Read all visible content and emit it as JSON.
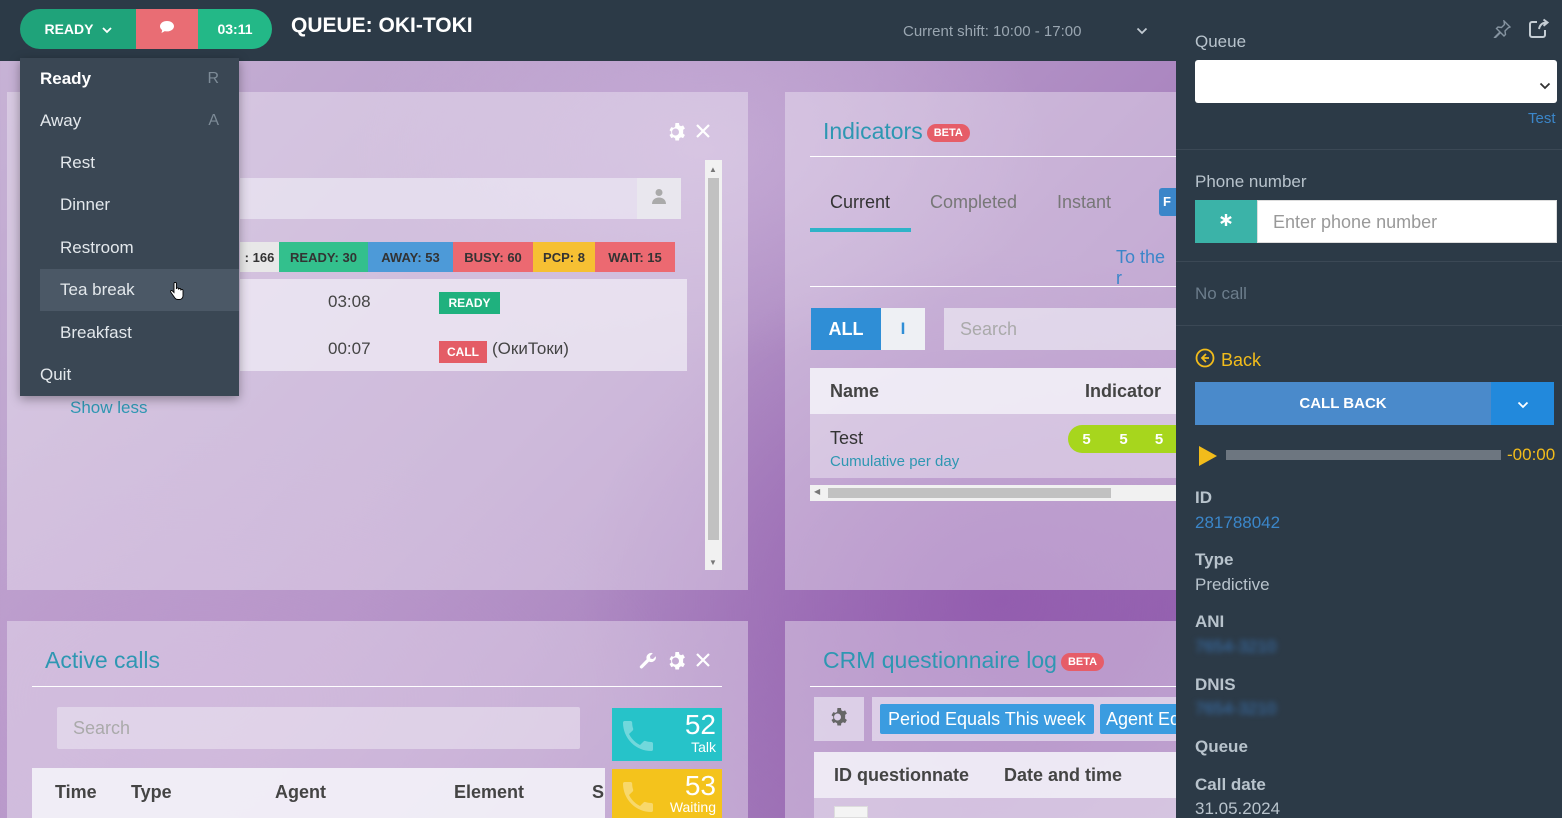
{
  "topbar": {
    "status_label": "READY",
    "timer": "03:11",
    "queue_title": "QUEUE: OKI-TOKI",
    "shift_text": "Current shift: 10:00 - 17:00"
  },
  "status_menu": {
    "items": [
      {
        "label": "Ready",
        "key": "R"
      },
      {
        "label": "Away",
        "key": "A"
      },
      {
        "label": "Rest"
      },
      {
        "label": "Dinner"
      },
      {
        "label": "Restroom"
      },
      {
        "label": "Tea break"
      },
      {
        "label": "Breakfast"
      },
      {
        "label": "Quit"
      }
    ]
  },
  "agents_panel": {
    "chips": [
      {
        "label": ": 166",
        "color": "#e8e8e8"
      },
      {
        "label": "READY: 30",
        "color": "#33c08d"
      },
      {
        "label": "AWAY: 53",
        "color": "#4d9ad8"
      },
      {
        "label": "BUSY: 60",
        "color": "#ec6971"
      },
      {
        "label": "PCP: 8",
        "color": "#f6c033"
      },
      {
        "label": "WAIT: 15",
        "color": "#ec6971"
      }
    ],
    "rows": [
      {
        "time": "03:08",
        "badge": "READY",
        "extra": ""
      },
      {
        "time": "00:07",
        "badge": "CALL",
        "extra": "(ОкиТоки)"
      }
    ],
    "show_less": "Show less"
  },
  "indicators_panel": {
    "title": "Indicators",
    "beta": "BETA",
    "tabs": [
      "Current",
      "Completed",
      "Instant"
    ],
    "link": "To the r",
    "filter_all": "ALL",
    "filter_i": "I",
    "search_placeholder": "Search",
    "col_name": "Name",
    "col_indicator": "Indicator",
    "row_name": "Test",
    "row_sub": "Cumulative per day",
    "row_values": [
      "5",
      "5",
      "5"
    ]
  },
  "active_calls_panel": {
    "title": "Active calls",
    "search_placeholder": "Search",
    "talk_count": "52",
    "talk_label": "Talk",
    "waiting_count": "53",
    "waiting_label": "Waiting",
    "columns": [
      "Time",
      "Type",
      "Agent",
      "Element",
      "S"
    ]
  },
  "crm_panel": {
    "title": "CRM questionnaire log",
    "beta": "BETA",
    "filter1": "Period Equals This week",
    "filter2": "Agent Eq",
    "col_id": "ID questionnate",
    "col_date": "Date and time"
  },
  "sidebar": {
    "queue_label": "Queue",
    "queue_link": "Test",
    "phone_label": "Phone number",
    "phone_placeholder": "Enter phone number",
    "no_call": "No call",
    "back": "Back",
    "call_back": "CALL BACK",
    "audio_time": "-00:00",
    "id_label": "ID",
    "id_value": "281788042",
    "type_label": "Type",
    "type_value": "Predictive",
    "ani_label": "ANI",
    "ani_value": "7654-3210",
    "dnis_label": "DNIS",
    "dnis_value": "7654-3210",
    "queue2_label": "Queue",
    "call_date_label": "Call date",
    "call_date_value": "31.05.2024"
  }
}
